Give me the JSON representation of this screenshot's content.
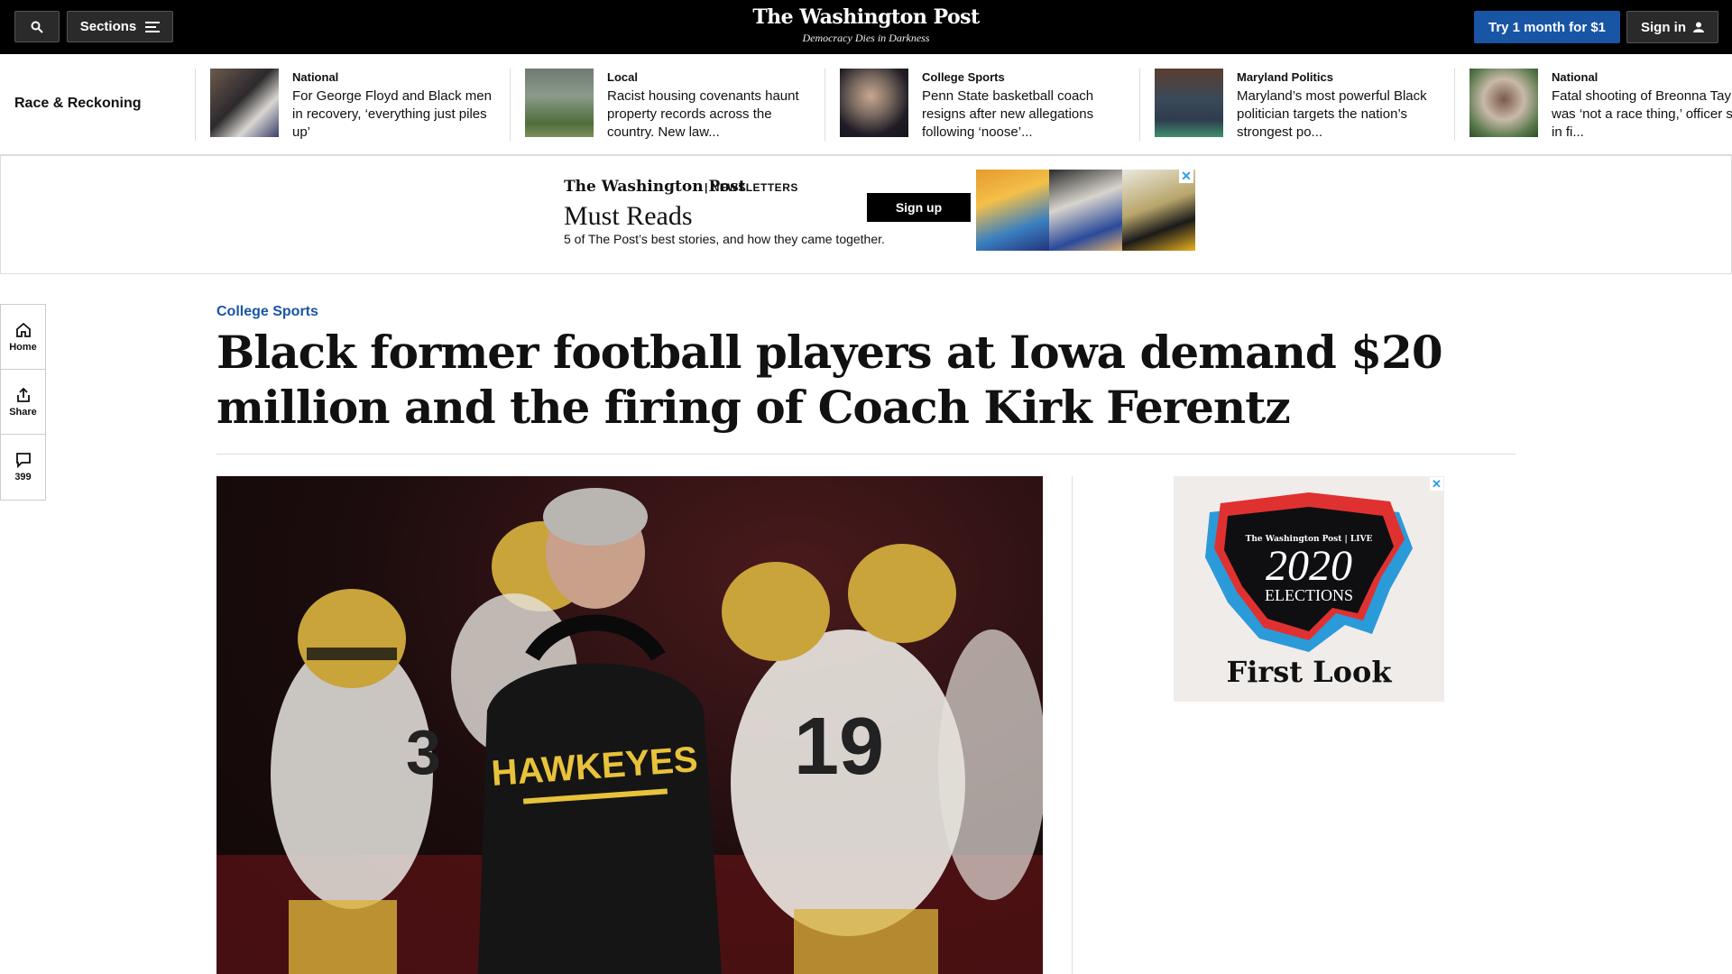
{
  "header": {
    "sections_label": "Sections",
    "logo": "The Washington Post",
    "tagline": "Democracy Dies in Darkness",
    "try_label": "Try 1 month for $1",
    "signin_label": "Sign in"
  },
  "strip": {
    "title": "Race & Reckoning",
    "items": [
      {
        "kicker": "National",
        "headline": "For George Floyd and Black men in recovery, ‘everything just piles up’"
      },
      {
        "kicker": "Local",
        "headline": "Racist housing covenants haunt property records across the country. New law..."
      },
      {
        "kicker": "College Sports",
        "headline": "Penn State basketball coach resigns after new allegations following ‘noose’..."
      },
      {
        "kicker": "Maryland Politics",
        "headline": "Maryland’s most powerful Black politician targets the nation’s strongest po..."
      },
      {
        "kicker": "National",
        "headline": "Fatal shooting of Breonna Taylor was ‘not a race thing,’ officer says in fi..."
      }
    ]
  },
  "ad_banner": {
    "brand": "The Washington Post",
    "newsletters": "| NEWSLETTERS",
    "title": "Must Reads",
    "description": "5 of The Post’s best stories, and how they came together.",
    "signup": "Sign up",
    "close": "✕"
  },
  "rail": {
    "home": "Home",
    "share": "Share",
    "comments": "399"
  },
  "article": {
    "kicker": "College Sports",
    "headline": "Black former football players at Iowa demand $20 million and the firing of Coach Kirk Ferentz"
  },
  "photo": {
    "shirt_text": "HAWKEYES"
  },
  "side_ad": {
    "brand": "The Washington Post | LIVE",
    "year": "2020",
    "label": "ELECTIONS",
    "footer": "First Look",
    "close": "✕"
  },
  "colors": {
    "accent": "#1955a5",
    "header_bg": "#000000",
    "ad_close": "#2a9de8"
  }
}
